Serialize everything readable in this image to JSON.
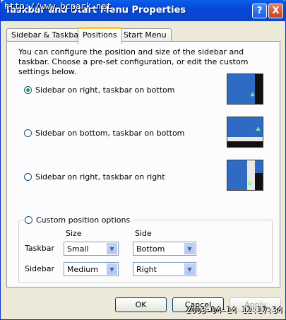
{
  "window": {
    "title": "Taskbar and Start Menu Properties",
    "watermark": "http://www.bcpark.net",
    "help_label": "?",
    "close_label": "X"
  },
  "tabs": [
    {
      "label": "Sidebar & Taskbar",
      "active": false
    },
    {
      "label": "Positions",
      "active": true
    },
    {
      "label": "Start Menu",
      "active": false
    }
  ],
  "positions": {
    "intro": "You can configure the position and size of the sidebar and taskbar. Choose a pre-set configuration, or edit the custom settings below.",
    "options": [
      {
        "label": "Sidebar on right, taskbar on bottom",
        "checked": true
      },
      {
        "label": "Sidebar on bottom, taskbar on bottom",
        "checked": false
      },
      {
        "label": "Sidebar on right, taskbar on right",
        "checked": false
      }
    ],
    "custom": {
      "label": "Custom position options",
      "checked": false,
      "size_header": "Size",
      "side_header": "Side",
      "rows": [
        {
          "label": "Taskbar",
          "size": "Small",
          "side": "Bottom"
        },
        {
          "label": "Sidebar",
          "size": "Medium",
          "side": "Right"
        }
      ]
    }
  },
  "buttons": {
    "ok": "OK",
    "cancel": "Cancel",
    "apply": "Apply"
  },
  "timestamp": "2003-04-14 12:17:34",
  "colors": {
    "title_bar": "#0A5FE8",
    "desktop_preview": "#2F6BC5",
    "tab_highlight": "#FFC83C"
  }
}
